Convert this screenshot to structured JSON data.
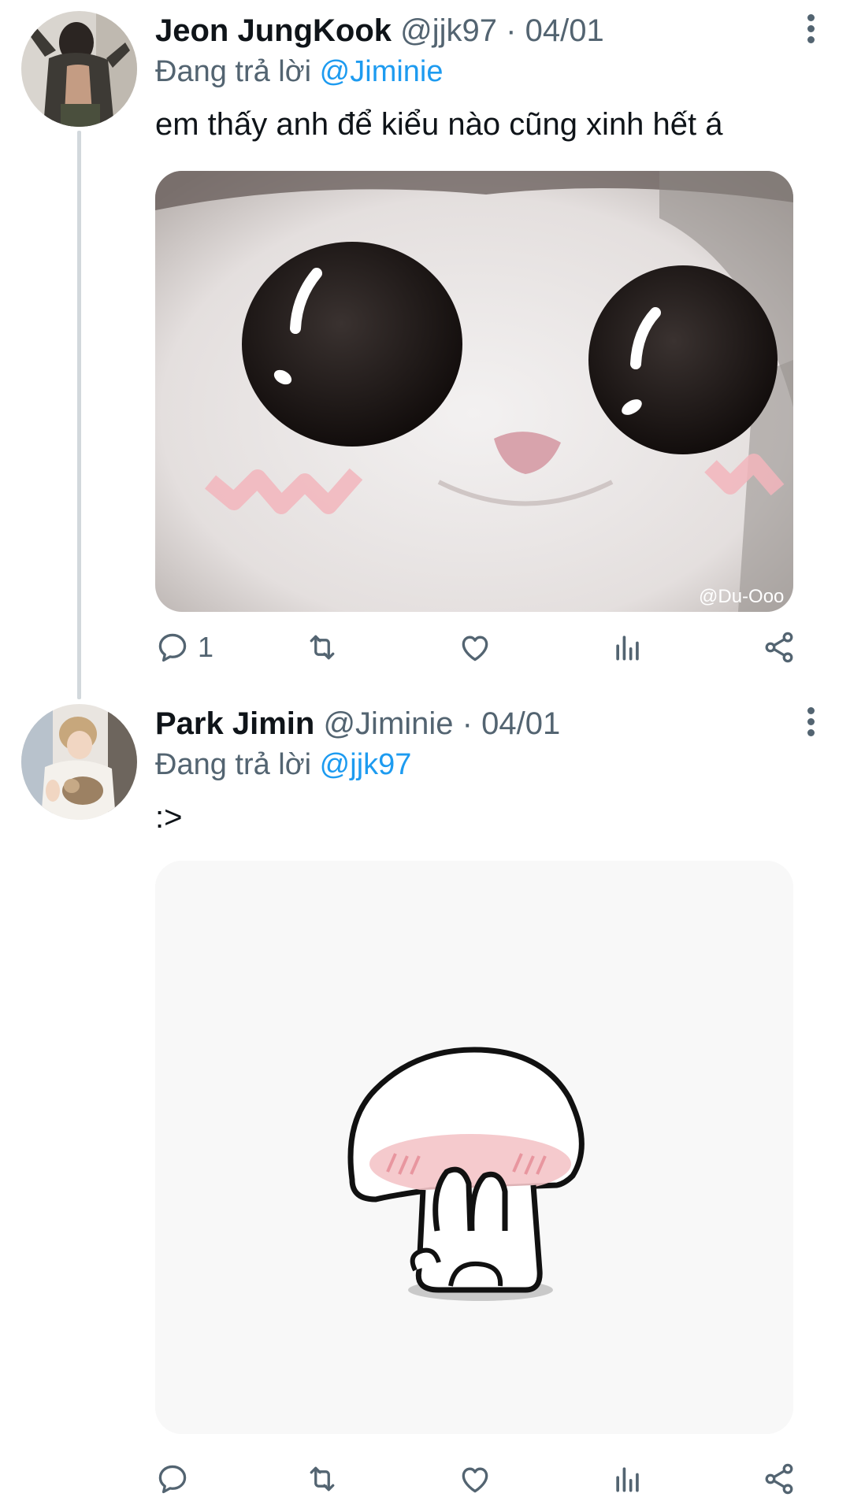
{
  "tweets": [
    {
      "author": "Jeon JungKook",
      "handle": "@jjk97",
      "date": "· 04/01",
      "reply_prefix": "Đang trả lời",
      "reply_to": "@Jiminie",
      "text": "em thấy anh để kiểu nào cũng xinh hết á",
      "media_watermark": "@Du-Ooo",
      "reply_count": "1"
    },
    {
      "author": "Park Jimin",
      "handle": "@Jiminie",
      "date": "· 04/01",
      "reply_prefix": "Đang trả lời",
      "reply_to": "@jjk97",
      "text": ":>",
      "reply_count": ""
    }
  ],
  "icons": {
    "reply": "reply-icon",
    "retweet": "retweet-icon",
    "like": "heart-icon",
    "analytics": "analytics-icon",
    "share": "share-icon",
    "more": "more-vertical-icon"
  },
  "colors": {
    "link": "#1d9bf0",
    "secondary_text": "#536471",
    "primary_text": "#0f1419",
    "thread_line": "#d2d8dc"
  }
}
